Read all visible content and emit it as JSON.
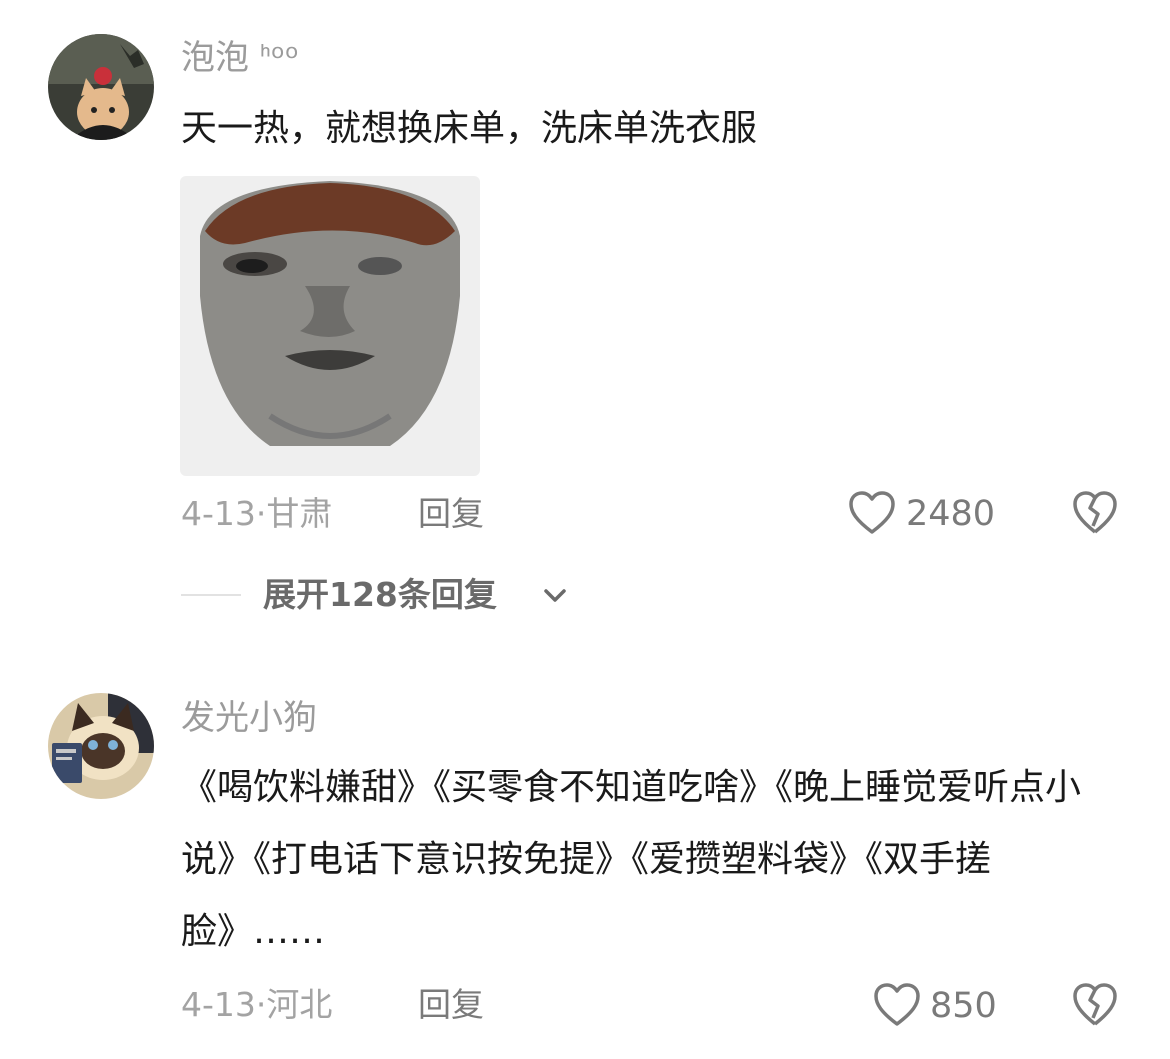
{
  "comments": [
    {
      "username": "泡泡 ᑋᵒᵒ",
      "text": "天一热，就想换床单，洗床单洗衣服",
      "date": "4-13",
      "location": "甘肃",
      "reply_label": "回复",
      "likes": "2480",
      "expand_label": "展开128条回复",
      "avatar_icon": "cat-with-apple-avatar",
      "image_icon": "face-meme-image"
    },
    {
      "username": "发光小狗",
      "text": "《喝饮料嫌甜》《买零食不知道吃啥》《晚上睡觉爱听点小说》《打电话下意识按免提》《爱攒塑料袋》《双手搓脸》……",
      "date": "4-13",
      "location": "河北",
      "reply_label": "回复",
      "likes": "850",
      "avatar_icon": "siamese-cat-avatar"
    }
  ],
  "icons": {
    "like": "heart-outline-icon",
    "dislike": "broken-heart-icon",
    "expand": "chevron-down-icon"
  },
  "colors": {
    "username": "#9b9b9b",
    "text": "#1a1a1a",
    "meta": "#a3a3a3"
  }
}
